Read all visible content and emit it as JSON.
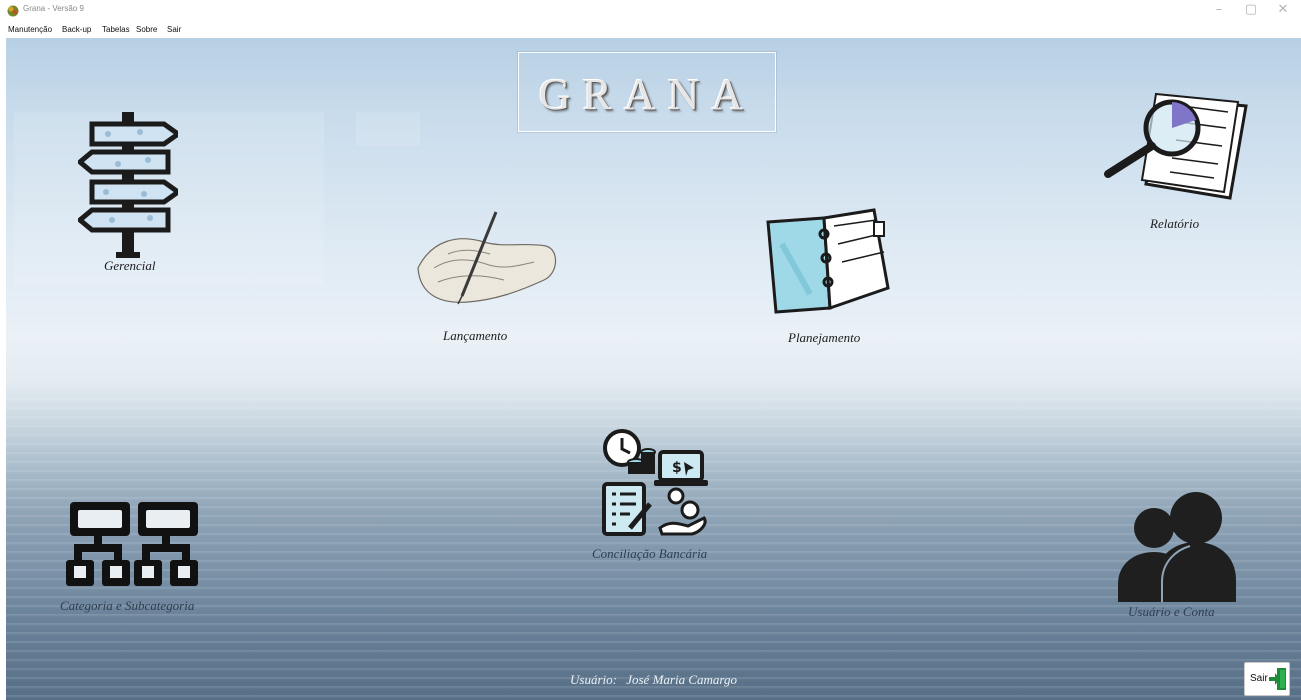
{
  "window": {
    "title": "Grana - Versão 9",
    "icon": "grana-app-icon",
    "controls": [
      "–",
      "▢",
      "✕"
    ]
  },
  "menu": [
    {
      "label": "Manutenção"
    },
    {
      "label": "Back-up"
    },
    {
      "label": "Tabelas"
    },
    {
      "label": "Sobre"
    },
    {
      "label": "Sair"
    }
  ],
  "logo": {
    "text": "GRANA"
  },
  "tiles": {
    "gerencial": {
      "label": "Gerencial",
      "icon": "signpost-icon"
    },
    "lancamento": {
      "label": "Lançamento",
      "icon": "hand-writing-icon"
    },
    "planejamento": {
      "label": "Planejamento",
      "icon": "planner-binder-icon"
    },
    "relatorio": {
      "label": "Relatório",
      "icon": "report-magnifier-icon"
    },
    "categoria": {
      "label": "Categoria e Subcategoria",
      "icon": "hierarchy-icon"
    },
    "conciliacao": {
      "label": "Conciliação Bancária",
      "icon": "bank-reconciliation-icon"
    },
    "usuario": {
      "label": "Usuário e Conta",
      "icon": "users-icon"
    }
  },
  "footer": {
    "user_label": "Usuário:",
    "user_name": "José Maria Camargo"
  },
  "exit_button": {
    "label": "Sair",
    "icon": "exit-door-icon"
  },
  "colors": {
    "sky_top": "#b7d0e4",
    "horizon": "#eaf1f7",
    "sea_bottom": "#576f86",
    "accent_cyan": "#8fd8e8",
    "icon_dark": "#1b1b1b"
  }
}
